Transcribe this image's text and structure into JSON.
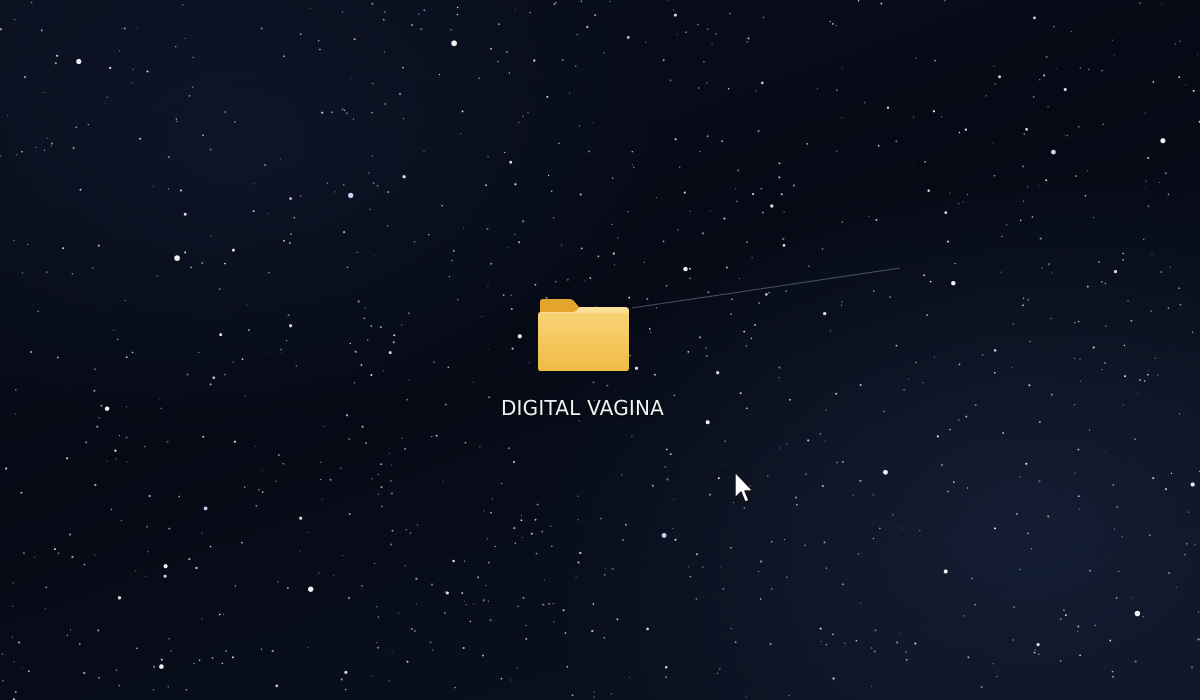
{
  "desktop": {
    "wallpaper": "starry-night-sky",
    "colors": {
      "sky": "#070b16",
      "folder_back": "#e3a62b",
      "folder_front": "#f6c85a",
      "label_text": "#f2f2f2"
    },
    "icons": [
      {
        "type": "folder-icon",
        "label": "DIGITAL VAGINA"
      }
    ],
    "pointer": "arrow-cursor-icon"
  }
}
